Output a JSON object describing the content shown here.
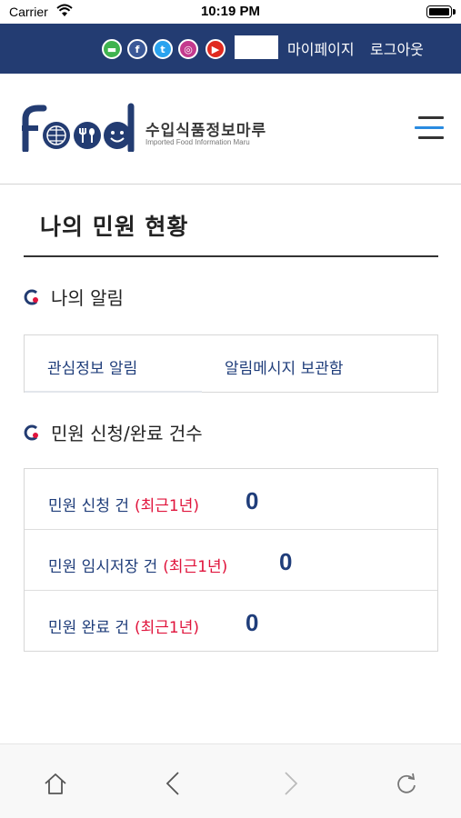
{
  "status_bar": {
    "carrier": "Carrier",
    "time": "10:19 PM"
  },
  "top_bar": {
    "background": "#233c72",
    "sns_icons": [
      "line-icon",
      "facebook-icon",
      "twitter-icon",
      "instagram-icon",
      "youtube-icon"
    ],
    "mypage_label": "마이페이지",
    "logout_label": "로그아웃"
  },
  "header": {
    "logo_text": "food",
    "site_name_ko": "수입식품정보마루",
    "site_name_en": "Imported Food Information Maru"
  },
  "page": {
    "title": "나의 민원 현황"
  },
  "notifications": {
    "heading": "나의 알림",
    "tabs": [
      {
        "label": "관심정보 알림"
      },
      {
        "label": "알림메시지 보관함"
      }
    ]
  },
  "complaints": {
    "heading": "민원 신청/완료 건수",
    "rows": [
      {
        "label": "민원 신청 건",
        "period": "(최근1년)",
        "count": "0"
      },
      {
        "label": "민원 임시저장 건",
        "period": "(최근1년)",
        "count": "0"
      },
      {
        "label": "민원 완료 건",
        "period": "(최근1년)",
        "count": "0"
      }
    ]
  },
  "bottom_bar": {
    "buttons": [
      "home-icon",
      "back-icon",
      "forward-icon",
      "reload-icon"
    ]
  },
  "colors": {
    "brand_navy": "#233c72",
    "link_navy": "#1f3d7a",
    "accent_red": "#e0143c",
    "menu_accent_blue": "#2a8be0"
  }
}
